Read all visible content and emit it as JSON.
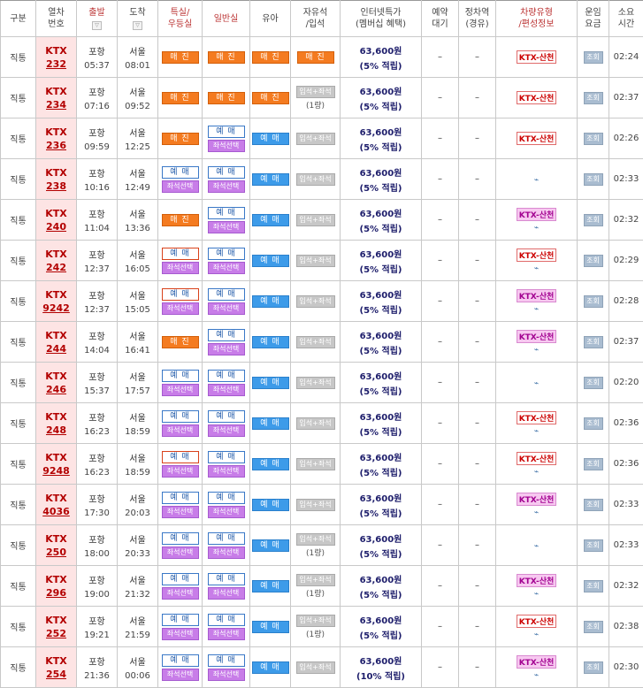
{
  "headers": {
    "type": "구분",
    "train_no": "열차\n번호",
    "depart": "출발",
    "arrive": "도착",
    "special": "특실/\n우등실",
    "general": "일반실",
    "infant": "유아",
    "standing": "자유석\n/입석",
    "internet": "인터넷특가\n(멤버십 혜택)",
    "reserve_wait": "예약\n대기",
    "stops": "정차역\n(경유)",
    "car_type": "차량유형\n/편성정보",
    "fare": "운임\n요금",
    "duration": "소요\n시간",
    "sort_icon": "▽"
  },
  "labels": {
    "sold": "매 진",
    "book": "예 매",
    "seat": "좌석선택",
    "standing": "입석+좌석",
    "view": "조회",
    "ktx_sancheon": "KTX-산천",
    "dash": "–",
    "route_icon": "⌁"
  },
  "rows": [
    {
      "kind": "직통",
      "type": "KTX",
      "no": "232",
      "from": "포항",
      "dep": "05:37",
      "to": "서울",
      "arr": "08:01",
      "special": "sold",
      "general": "sold",
      "infant": "sold",
      "standing": "sold",
      "count": "",
      "fare": "63,600원",
      "benefit": "(5% 적립)",
      "car": "ktx",
      "icon": false,
      "dur": "02:24"
    },
    {
      "kind": "직통",
      "type": "KTX",
      "no": "234",
      "from": "포항",
      "dep": "07:16",
      "to": "서울",
      "arr": "09:52",
      "special": "sold",
      "general": "sold",
      "infant": "sold",
      "standing": "grey",
      "count": "(1량)",
      "fare": "63,600원",
      "benefit": "(5% 적립)",
      "car": "ktx",
      "icon": false,
      "dur": "02:37"
    },
    {
      "kind": "직통",
      "type": "KTX",
      "no": "236",
      "from": "포항",
      "dep": "09:59",
      "to": "서울",
      "arr": "12:25",
      "special": "sold",
      "general": "okseat",
      "infant": "blue",
      "standing": "grey",
      "count": "",
      "fare": "63,600원",
      "benefit": "(5% 적립)",
      "car": "ktx",
      "icon": false,
      "dur": "02:26"
    },
    {
      "kind": "직통",
      "type": "KTX",
      "no": "238",
      "from": "포항",
      "dep": "10:16",
      "to": "서울",
      "arr": "12:49",
      "special": "okseat",
      "general": "okseat",
      "infant": "blue",
      "standing": "grey",
      "count": "",
      "fare": "63,600원",
      "benefit": "(5% 적립)",
      "car": "none",
      "icon": true,
      "dur": "02:33"
    },
    {
      "kind": "직통",
      "type": "KTX",
      "no": "240",
      "from": "포항",
      "dep": "11:04",
      "to": "서울",
      "arr": "13:36",
      "special": "sold",
      "general": "okseat",
      "infant": "blue",
      "standing": "grey",
      "count": "",
      "fare": "63,600원",
      "benefit": "(5% 적립)",
      "car": "pink",
      "icon": true,
      "dur": "02:32"
    },
    {
      "kind": "직통",
      "type": "KTX",
      "no": "242",
      "from": "포항",
      "dep": "12:37",
      "to": "서울",
      "arr": "16:05",
      "special": "okseatred",
      "general": "okseat",
      "infant": "blue",
      "standing": "grey",
      "count": "",
      "fare": "63,600원",
      "benefit": "(5% 적립)",
      "car": "ktx",
      "icon": true,
      "dur": "02:29"
    },
    {
      "kind": "직통",
      "type": "KTX",
      "no": "9242",
      "from": "포항",
      "dep": "12:37",
      "to": "서울",
      "arr": "15:05",
      "special": "okseatred",
      "general": "okseat",
      "infant": "blue",
      "standing": "grey",
      "count": "",
      "fare": "63,600원",
      "benefit": "(5% 적립)",
      "car": "pink",
      "icon": true,
      "dur": "02:28"
    },
    {
      "kind": "직통",
      "type": "KTX",
      "no": "244",
      "from": "포항",
      "dep": "14:04",
      "to": "서울",
      "arr": "16:41",
      "special": "sold",
      "general": "okseat",
      "infant": "blue",
      "standing": "grey",
      "count": "",
      "fare": "63,600원",
      "benefit": "(5% 적립)",
      "car": "pink",
      "icon": true,
      "dur": "02:37"
    },
    {
      "kind": "직통",
      "type": "KTX",
      "no": "246",
      "from": "포항",
      "dep": "15:37",
      "to": "서울",
      "arr": "17:57",
      "special": "okseat",
      "general": "okseat",
      "infant": "blue",
      "standing": "grey",
      "count": "",
      "fare": "63,600원",
      "benefit": "(5% 적립)",
      "car": "none",
      "icon": true,
      "dur": "02:20"
    },
    {
      "kind": "직통",
      "type": "KTX",
      "no": "248",
      "from": "포항",
      "dep": "16:23",
      "to": "서울",
      "arr": "18:59",
      "special": "okseat",
      "general": "okseat",
      "infant": "blue",
      "standing": "grey",
      "count": "",
      "fare": "63,600원",
      "benefit": "(5% 적립)",
      "car": "ktx",
      "icon": true,
      "dur": "02:36"
    },
    {
      "kind": "직통",
      "type": "KTX",
      "no": "9248",
      "from": "포항",
      "dep": "16:23",
      "to": "서울",
      "arr": "18:59",
      "special": "okseatred",
      "general": "okseat",
      "infant": "blue",
      "standing": "grey",
      "count": "",
      "fare": "63,600원",
      "benefit": "(5% 적립)",
      "car": "ktx",
      "icon": true,
      "dur": "02:36"
    },
    {
      "kind": "직통",
      "type": "KTX",
      "no": "4036",
      "from": "포항",
      "dep": "17:30",
      "to": "서울",
      "arr": "20:03",
      "special": "okseat",
      "general": "okseat",
      "infant": "blue",
      "standing": "grey",
      "count": "",
      "fare": "63,600원",
      "benefit": "(5% 적립)",
      "car": "pink",
      "icon": true,
      "dur": "02:33"
    },
    {
      "kind": "직통",
      "type": "KTX",
      "no": "250",
      "from": "포항",
      "dep": "18:00",
      "to": "서울",
      "arr": "20:33",
      "special": "okseat",
      "general": "okseat",
      "infant": "blue",
      "standing": "grey",
      "count": "(1량)",
      "fare": "63,600원",
      "benefit": "(5% 적립)",
      "car": "none",
      "icon": true,
      "dur": "02:33"
    },
    {
      "kind": "직통",
      "type": "KTX",
      "no": "296",
      "from": "포항",
      "dep": "19:00",
      "to": "서울",
      "arr": "21:32",
      "special": "okseat",
      "general": "okseat",
      "infant": "blue",
      "standing": "grey",
      "count": "(1량)",
      "fare": "63,600원",
      "benefit": "(5% 적립)",
      "car": "pink",
      "icon": true,
      "dur": "02:32"
    },
    {
      "kind": "직통",
      "type": "KTX",
      "no": "252",
      "from": "포항",
      "dep": "19:21",
      "to": "서울",
      "arr": "21:59",
      "special": "okseat",
      "general": "okseat",
      "infant": "blue",
      "standing": "grey",
      "count": "(1량)",
      "fare": "63,600원",
      "benefit": "(5% 적립)",
      "car": "ktx",
      "icon": true,
      "dur": "02:38"
    },
    {
      "kind": "직통",
      "type": "KTX",
      "no": "254",
      "from": "포항",
      "dep": "21:36",
      "to": "서울",
      "arr": "00:06",
      "special": "okseat",
      "general": "okseat",
      "infant": "blue",
      "standing": "grey",
      "count": "",
      "fare": "63,600원",
      "benefit": "(10% 적립)",
      "car": "pink",
      "icon": true,
      "dur": "02:30"
    }
  ]
}
